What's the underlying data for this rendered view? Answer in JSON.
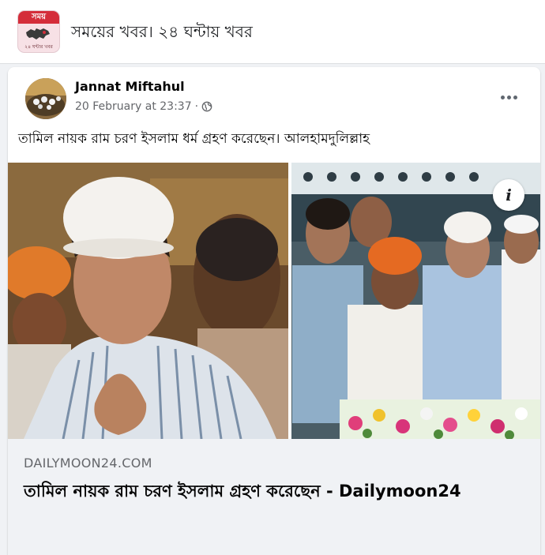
{
  "group": {
    "logo_text": "সময়",
    "logo_subtext": "২৪ ঘন্টার খবর",
    "title": "সময়ের খবর। ২৪ ঘন্টায় খবর"
  },
  "post": {
    "author": "Jannat Miftahul",
    "timestamp": "20 February at 23:37",
    "meta_separator": "·",
    "privacy_icon": "globe-icon",
    "more_icon": "more-options-icon",
    "text": "তামিল নায়ক রাম চরণ ইসলাম ধর্ম গ্রহণ করেছেন। আলহামদুলিল্লাহ"
  },
  "link_preview": {
    "info_label": "i",
    "domain": "DAILYMOON24.COM",
    "title": "তামিল নায়ক রাম চরণ ইসলাম গ্রহণ করেছেন - Dailymoon24"
  },
  "colors": {
    "background": "#f0f2f5",
    "card": "#ffffff",
    "secondary_text": "#65676b",
    "logo_accent": "#d42d3a"
  }
}
